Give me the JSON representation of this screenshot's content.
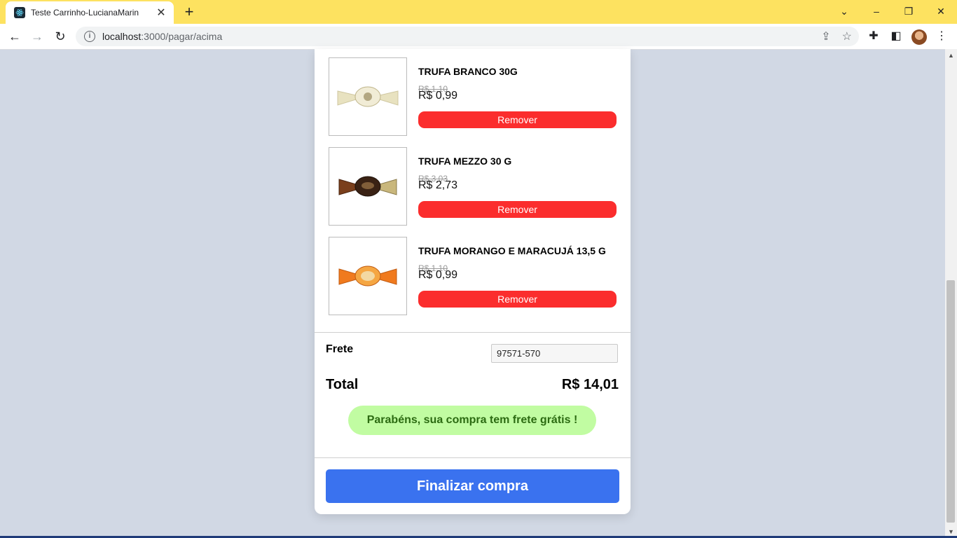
{
  "browser": {
    "tab_title": "Teste Carrinho-LucianaMarin",
    "url_host": "localhost",
    "url_path": ":3000/pagar/acima"
  },
  "cart": {
    "items": [
      {
        "name": "TRUFA BRANCO 30G",
        "old_price": "R$ 1,10",
        "price": "R$ 0,99",
        "remove_label": "Remover",
        "wrapper_color": "#e9e3c2",
        "center_color": "#f1ecd6"
      },
      {
        "name": "TRUFA MEZZO 30 G",
        "old_price": "R$ 3,03",
        "price": "R$ 2,73",
        "remove_label": "Remover",
        "wrapper_color": "#7a3f1c",
        "center_color": "#3a2214"
      },
      {
        "name": "TRUFA MORANGO E MARACUJÁ 13,5 G",
        "old_price": "R$ 1,10",
        "price": "R$ 0,99",
        "remove_label": "Remover",
        "wrapper_color": "#f07a1e",
        "center_color": "#f3d9a3"
      }
    ],
    "frete_label": "Frete",
    "cep_value": "97571-570",
    "total_label": "Total",
    "total_value": "R$ 14,01",
    "free_shipping_message": "Parabéns, sua compra tem frete grátis !",
    "finish_label": "Finalizar compra"
  },
  "colors": {
    "remove": "#fb2d2d",
    "finish": "#3a72ef",
    "free_badge": "#c1fca2",
    "tab_bar": "#fde260"
  }
}
